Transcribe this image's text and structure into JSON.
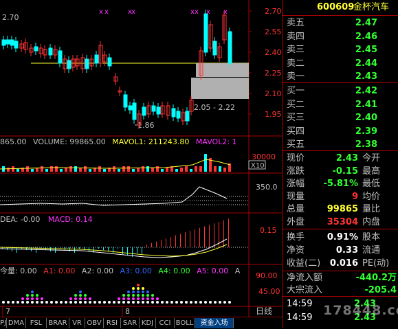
{
  "stock": {
    "code": "600609",
    "name": "金杯汽车"
  },
  "price_axis": [
    "2.70",
    "2.55",
    "2.40",
    "2.25",
    "2.10",
    "1.95"
  ],
  "left_label": "2.70",
  "range_label": "2.05 - 2.22",
  "low_label": "1.86",
  "vol_axis": [
    "30000",
    "X10"
  ],
  "kdj_axis": "350.0",
  "macd_axis": "0.15",
  "bottom_axis": [
    "90.00",
    "45.00"
  ],
  "vol_bar": {
    "prefix": "865.00",
    "volume": "VOLUME: 99865.00",
    "mavol1": "MAVOL1: 211243.80",
    "mavol2": "MAVOL2: 1"
  },
  "macd_bar": {
    "dea": "DEA: -0.00",
    "macd": "MACD: 0.14"
  },
  "ind_bar": {
    "a": "今量: 0.00",
    "a1": "A1: 0.00",
    "a2": "A2: 0.00",
    "a3": "A3: 0.00",
    "a4": "A4: 0.00",
    "a5": "A5: 0.00",
    "a6": "A"
  },
  "date_marks": [
    "7",
    "8"
  ],
  "period": "日线",
  "asks": [
    {
      "label": "卖五",
      "price": "2.47"
    },
    {
      "label": "卖四",
      "price": "2.46"
    },
    {
      "label": "卖三",
      "price": "2.45"
    },
    {
      "label": "卖二",
      "price": "2.44"
    },
    {
      "label": "卖一",
      "price": "2.43"
    }
  ],
  "bids": [
    {
      "label": "买一",
      "price": "2.42"
    },
    {
      "label": "买二",
      "price": "2.41"
    },
    {
      "label": "买三",
      "price": "2.40"
    },
    {
      "label": "买四",
      "price": "2.39"
    },
    {
      "label": "买五",
      "price": "2.38"
    }
  ],
  "stats": [
    {
      "label": "现价",
      "value": "2.43",
      "label2": "今开",
      "color": "#33ff33"
    },
    {
      "label": "涨跌",
      "value": "-0.15",
      "label2": "最高",
      "color": "#33ff33"
    },
    {
      "label": "涨幅",
      "value": "-5.81%",
      "label2": "最低",
      "color": "#33ff33"
    },
    {
      "label": "现量",
      "value": "9",
      "label2": "均价",
      "color": "#ff3333"
    },
    {
      "label": "总量",
      "value": "99865",
      "label2": "量比",
      "color": "#ffff33"
    },
    {
      "label": "外盘",
      "value": "35304",
      "label2": "内盘",
      "color": "#ff3333"
    }
  ],
  "stats2": [
    {
      "label": "换手",
      "value": "0.91%",
      "label2": "股本"
    },
    {
      "label": "净资",
      "value": "0.33",
      "label2": "流通"
    },
    {
      "label": "收益(二)",
      "value": "0.016",
      "label2": "PE(动)"
    }
  ],
  "flows": [
    {
      "label": "净流入额",
      "value": "-440.2万"
    },
    {
      "label": "大宗流入",
      "value": "-205.4"
    }
  ],
  "ticks": [
    {
      "time": "14:59",
      "price": "2.43"
    },
    {
      "time": "14:59",
      "price": "2.43"
    }
  ],
  "watermark": "178448.com",
  "tabs": [
    "PJ",
    "DMA",
    "FSL",
    "BRAR",
    "VR",
    "OBV",
    "RSI",
    "SAR",
    "KDJ",
    "CCI",
    "BOLL",
    "资金入场"
  ],
  "colors": {
    "up": "#ff3333",
    "down": "#00ffff",
    "yellow": "#ffff33",
    "magenta": "#ff33ff",
    "green": "#33ff33",
    "grid": "#800000"
  }
}
